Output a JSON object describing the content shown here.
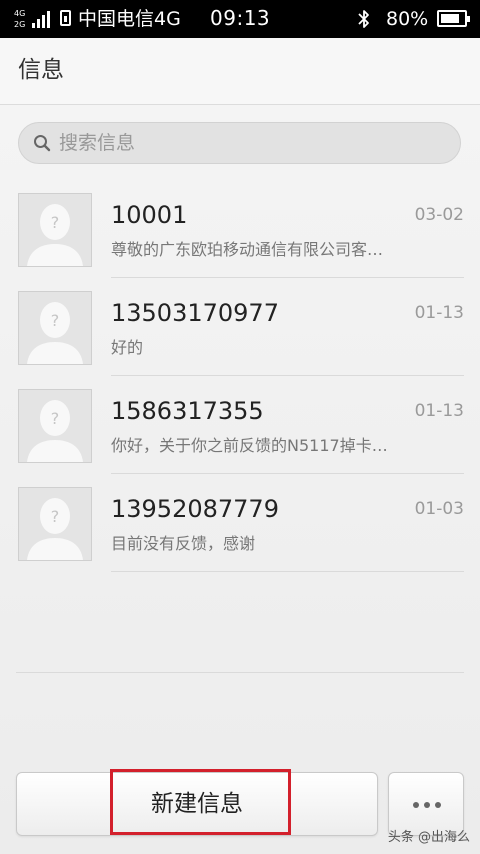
{
  "status_bar": {
    "network_top": "4G",
    "network_bottom": "2G",
    "carrier": "中国电信4G",
    "time": "09:13",
    "battery_percent": "80%",
    "battery_level": 0.8,
    "icons": [
      "signal-icon",
      "sim-icon",
      "bluetooth-icon",
      "battery-icon"
    ]
  },
  "header": {
    "title": "信息"
  },
  "search": {
    "placeholder": "搜索信息",
    "icon": "search-icon"
  },
  "conversations": [
    {
      "name": "10001",
      "date": "03-02",
      "preview": "尊敬的广东欧珀移动通信有限公司客…"
    },
    {
      "name": "13503170977",
      "date": "01-13",
      "preview": "好的"
    },
    {
      "name": "1586317355",
      "date": "01-13",
      "preview": "你好，关于你之前反馈的N5117掉卡…"
    },
    {
      "name": "13952087779",
      "date": "01-03",
      "preview": "目前没有反馈，感谢"
    }
  ],
  "bottom_bar": {
    "new_message_label": "新建信息",
    "more_icon": "more-icon",
    "highlight_color": "#d3202c"
  },
  "watermark": "头条 @出海么"
}
